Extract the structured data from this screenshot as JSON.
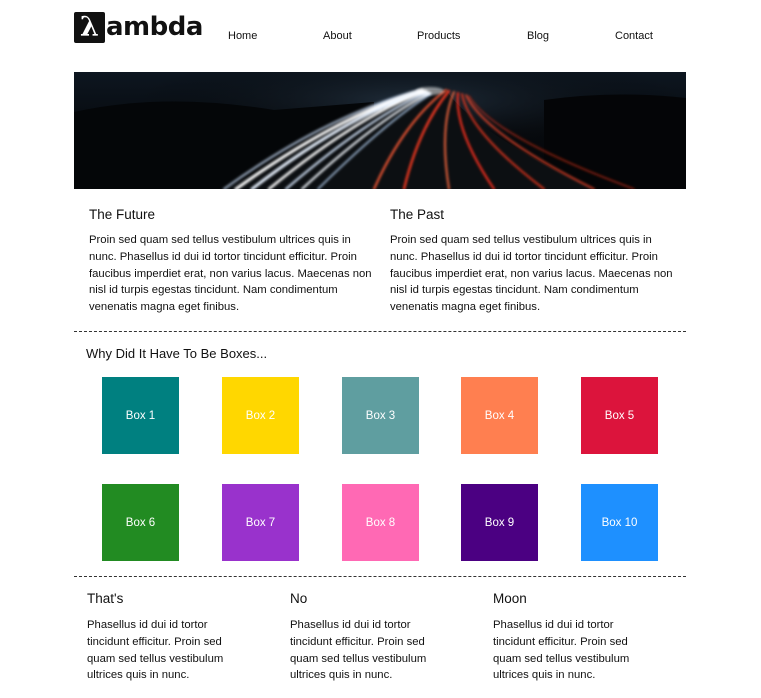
{
  "header": {
    "logo": {
      "mark": "λ",
      "text": "ambda"
    },
    "nav": [
      {
        "label": "Home"
      },
      {
        "label": "About"
      },
      {
        "label": "Products"
      },
      {
        "label": "Blog"
      },
      {
        "label": "Contact"
      }
    ]
  },
  "intro": {
    "columns": [
      {
        "title": "The Future",
        "text": "Proin sed quam sed tellus vestibulum ultrices quis in nunc. Phasellus id dui id tortor tincidunt efficitur. Proin faucibus imperdiet erat, non varius lacus. Maecenas non nisl id turpis egestas tincidunt. Nam condimentum venenatis magna eget finibus."
      },
      {
        "title": "The Past",
        "text": "Proin sed quam sed tellus vestibulum ultrices quis in nunc. Phasellus id dui id tortor tincidunt efficitur. Proin faucibus imperdiet erat, non varius lacus. Maecenas non nisl id turpis egestas tincidunt. Nam condimentum venenatis magna eget finibus."
      }
    ]
  },
  "boxes_section": {
    "title": "Why Did It Have To Be Boxes...",
    "boxes": [
      {
        "label": "Box 1",
        "color": "#008080"
      },
      {
        "label": "Box 2",
        "color": "#FFD700"
      },
      {
        "label": "Box 3",
        "color": "#5F9EA0"
      },
      {
        "label": "Box 4",
        "color": "#FF7F50"
      },
      {
        "label": "Box 5",
        "color": "#DC143C"
      },
      {
        "label": "Box 6",
        "color": "#228B22"
      },
      {
        "label": "Box 7",
        "color": "#9932CC"
      },
      {
        "label": "Box 8",
        "color": "#FF69B4"
      },
      {
        "label": "Box 9",
        "color": "#4B0082"
      },
      {
        "label": "Box 10",
        "color": "#1E90FF"
      }
    ]
  },
  "bottom": {
    "columns": [
      {
        "title": "That's",
        "text": "Phasellus id dui id tortor tincidunt efficitur. Proin sed quam sed tellus vestibulum ultrices quis in nunc."
      },
      {
        "title": "No",
        "text": "Phasellus id dui id tortor tincidunt efficitur. Proin sed quam sed tellus vestibulum ultrices quis in nunc."
      },
      {
        "title": "Moon",
        "text": "Phasellus id dui id tortor tincidunt efficitur. Proin sed quam sed tellus vestibulum ultrices quis in nunc."
      }
    ]
  }
}
